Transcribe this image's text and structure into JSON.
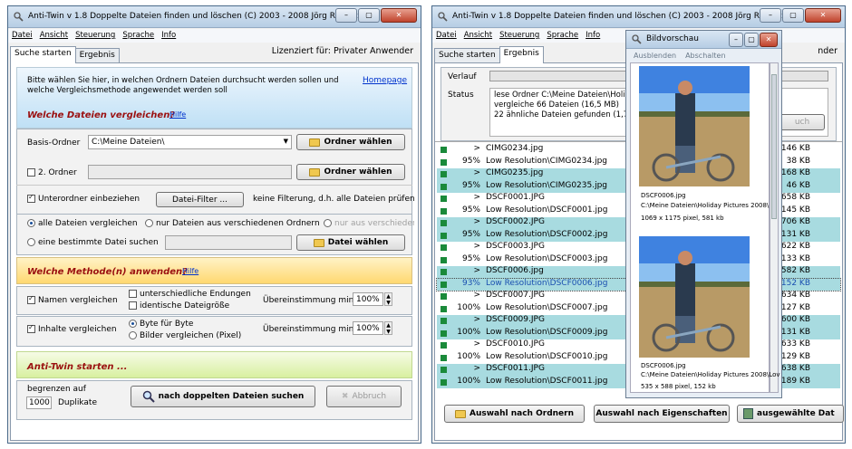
{
  "window1": {
    "title": "Anti-Twin  v 1.8   Doppelte Dateien finden und löschen   (C) 2003 - 2008  Jörg Rosenthal",
    "window_buttons": [
      "–",
      "▢",
      "✕"
    ],
    "menu": [
      "Datei",
      "Ansicht",
      "Steuerung",
      "Sprache",
      "Info"
    ],
    "tabs": [
      "Suche starten",
      "Ergebnis"
    ],
    "license": "Lizenziert für: Privater Anwender",
    "intro": "Bitte wählen Sie hier, in welchen Ordnern Dateien durchsucht werden sollen und welche Vergleichsmethode angewendet werden soll",
    "homepage": "Homepage",
    "section1": "Welche Dateien vergleichen?",
    "hilfe": "Hilfe",
    "basis_label": "Basis-Ordner",
    "basis_value": "C:\\Meine Dateien\\",
    "ordner_button": "Ordner wählen",
    "ordner2_label": "2. Ordner",
    "ordner2_button": "Ordner wählen",
    "unterordner": "Unterordner einbeziehen",
    "filter_button": "Datei-Filter ...",
    "filter_text": "keine Filterung, d.h. alle Dateien prüfen",
    "radio_all": "alle Dateien vergleichen",
    "radio_diff": "nur Dateien aus verschiedenen Ordnern",
    "radio_only": "nur aus verschieden",
    "radio_one": "eine bestimmte Datei suchen",
    "datei_button": "Datei wählen",
    "section2": "Welche Methode(n) anwenden?",
    "names_cb": "Namen vergleichen",
    "unterschiedliche": "unterschiedliche Endungen",
    "identische": "identische Dateigröße",
    "match_label": "Übereinstimmung min.",
    "match1": "100%",
    "inhalte_cb": "Inhalte vergleichen",
    "byte": "Byte für Byte",
    "bilder": "Bilder vergleichen (Pixel)",
    "match2": "100%",
    "section3": "Anti-Twin starten ...",
    "begrenzen": "begrenzen auf",
    "limit": "1000",
    "duplikate": "Duplikate",
    "search_button": "nach doppelten Dateien suchen",
    "abbruch": "Abbruch"
  },
  "window2": {
    "title": "Anti-Twin  v 1.8   Doppelte Dateien finden und löschen   (C) 2003 - 2008  Jörg Rosenthal",
    "menu": [
      "Datei",
      "Ansicht",
      "Steuerung",
      "Sprache",
      "Info"
    ],
    "tabs": [
      "Suche starten",
      "Ergebnis"
    ],
    "license_partial": "nder",
    "verlauf": "Verlauf",
    "status": "Status",
    "status_lines": [
      "lese Ordner C:\\Meine Dateien\\Holid",
      "vergleiche 66 Dateien (16,5 MB)",
      "22 ähnliche Dateien gefunden (1,7"
    ],
    "greyed_button": "uch",
    "rows": [
      {
        "pc": ">",
        "name": "CIMG0234.jpg",
        "size": "146 KB",
        "hl": false
      },
      {
        "pc": "95%",
        "name": "Low Resolution\\CIMG0234.jpg",
        "size": "38 KB",
        "hl": false
      },
      {
        "pc": ">",
        "name": "CIMG0235.jpg",
        "size": "168 KB",
        "hl": true
      },
      {
        "pc": "95%",
        "name": "Low Resolution\\CIMG0235.jpg",
        "size": "46 KB",
        "hl": true
      },
      {
        "pc": ">",
        "name": "DSCF0001.JPG",
        "size": "658 KB",
        "hl": false
      },
      {
        "pc": "95%",
        "name": "Low Resolution\\DSCF0001.jpg",
        "size": "145 KB",
        "hl": false
      },
      {
        "pc": ">",
        "name": "DSCF0002.JPG",
        "size": "706 KB",
        "hl": true
      },
      {
        "pc": "95%",
        "name": "Low Resolution\\DSCF0002.jpg",
        "size": "131 KB",
        "hl": true
      },
      {
        "pc": ">",
        "name": "DSCF0003.JPG",
        "size": "622 KB",
        "hl": false
      },
      {
        "pc": "95%",
        "name": "Low Resolution\\DSCF0003.jpg",
        "size": "133 KB",
        "hl": false
      },
      {
        "pc": ">",
        "name": "DSCF0006.jpg",
        "size": "582 KB",
        "hl": true
      },
      {
        "pc": "93%",
        "name": "Low Resolution\\DSCF0006.jpg",
        "size": "152 KB",
        "hl": true,
        "sel": true
      },
      {
        "pc": ">",
        "name": "DSCF0007.JPG",
        "size": "634 KB",
        "hl": false
      },
      {
        "pc": "100%",
        "name": "Low Resolution\\DSCF0007.jpg",
        "size": "127 KB",
        "hl": false
      },
      {
        "pc": ">",
        "name": "DSCF0009.JPG",
        "size": "600 KB",
        "hl": true
      },
      {
        "pc": "100%",
        "name": "Low Resolution\\DSCF0009.jpg",
        "size": "131 KB",
        "hl": true
      },
      {
        "pc": ">",
        "name": "DSCF0010.JPG",
        "size": "633 KB",
        "hl": false
      },
      {
        "pc": "100%",
        "name": "Low Resolution\\DSCF0010.jpg",
        "size": "129 KB",
        "hl": false
      },
      {
        "pc": ">",
        "name": "DSCF0011.JPG",
        "size": "638 KB",
        "hl": true
      },
      {
        "pc": "100%",
        "name": "Low Resolution\\DSCF0011.jpg",
        "size": "189 KB",
        "hl": true
      }
    ],
    "btn_ordner": "Auswahl nach Ordnern",
    "btn_eigen": "Auswahl nach Eigenschaften",
    "btn_del": "ausgewählte Dat"
  },
  "preview": {
    "title": "Bildvorschau",
    "menu": [
      "Ausblenden",
      "Abschalten"
    ],
    "img1_name": "DSCF0006.jpg",
    "img1_path": "C:\\Meine Dateien\\Holiday Pictures 2008\\",
    "img1_info": "1069 x 1175 pixel, 581 kb",
    "img2_name": "DSCF0006.jpg",
    "img2_path": "C:\\Meine Dateien\\Holiday Pictures 2008\\Lov",
    "img2_info": "535 x 588 pixel, 152 kb"
  }
}
